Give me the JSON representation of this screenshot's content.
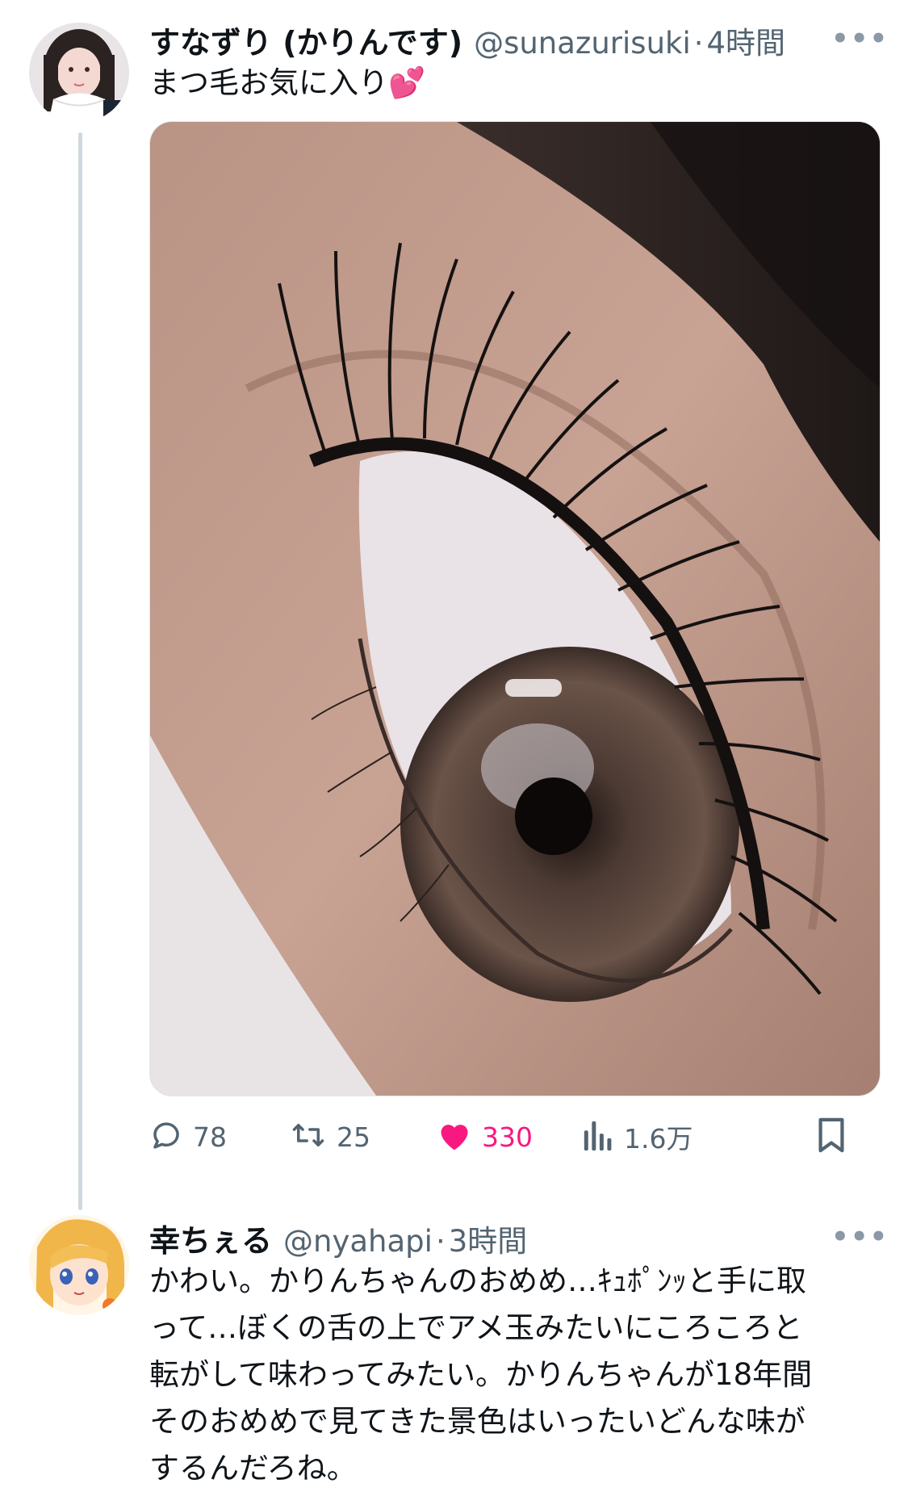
{
  "tweet1": {
    "author_name": "すなずり (かりんです)",
    "handle": "@sunazurisuki",
    "separator": "·",
    "time": "4時間",
    "more_label": "•••",
    "text": "まつ毛お気に入り💕",
    "media_alt": "まつ毛お気に入り",
    "actions": {
      "reply_count": "78",
      "retweet_count": "25",
      "like_count": "330",
      "views_count": "1.6万"
    },
    "like_color": "#f91880"
  },
  "tweet2": {
    "author_name": "幸ちぇる",
    "handle": "@nyahapi",
    "separator": "·",
    "time": "3時間",
    "more_label": "•••",
    "lines": [
      "かわい。かりんちゃんのおめめ…ｷｭﾎﾟﾝｯと手に取",
      "って…ぼくの舌の上でアメ玉みたいにころころと",
      "転がして味わってみたい。かりんちゃんが18年間",
      "そのおめめで見てきた景色はいったいどんな味が",
      "するんだろね。"
    ]
  },
  "colors": {
    "text_primary": "#0f1419",
    "text_secondary": "#536471",
    "thread_line": "#cfd9de"
  }
}
